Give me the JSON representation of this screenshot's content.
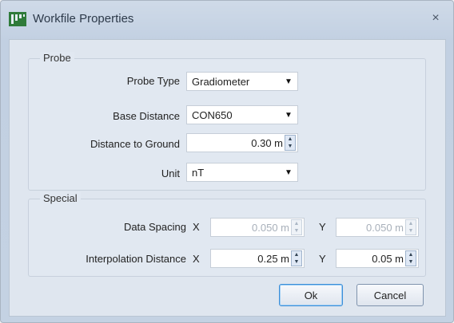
{
  "window": {
    "title": "Workfile Properties",
    "close_glyph": "×"
  },
  "probe": {
    "group_label": "Probe",
    "probe_type": {
      "label": "Probe Type",
      "value": "Gradiometer"
    },
    "base_distance": {
      "label": "Base Distance",
      "value": "CON650"
    },
    "distance_to_ground": {
      "label": "Distance to Ground",
      "value": "0.30 m"
    },
    "unit": {
      "label": "Unit",
      "value": "nT"
    }
  },
  "special": {
    "group_label": "Special",
    "data_spacing": {
      "label": "Data Spacing",
      "x_label": "X",
      "x_value": "0.050 m",
      "y_label": "Y",
      "y_value": "0.050 m",
      "enabled": false
    },
    "interpolation_distance": {
      "label": "Interpolation Distance",
      "x_label": "X",
      "x_value": "0.25 m",
      "y_label": "Y",
      "y_value": "0.05 m",
      "enabled": true
    }
  },
  "buttons": {
    "ok": "Ok",
    "cancel": "Cancel"
  },
  "icons": {
    "app": "app-logo-icon",
    "close": "close-icon",
    "dropdown": "chevron-down-icon",
    "spinner": "spin-updown-icon"
  },
  "colors": {
    "title_bar": "#c2d0e2",
    "client": "#dfe6ef",
    "default_button_border": "#3c8ed8"
  }
}
